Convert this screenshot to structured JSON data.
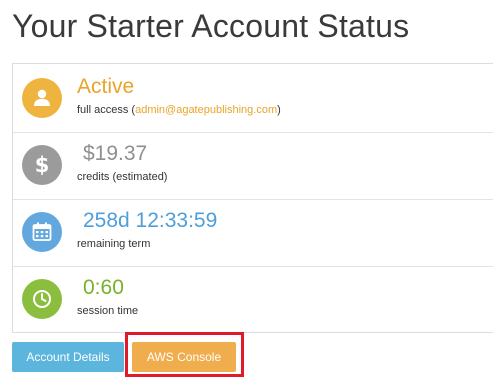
{
  "page": {
    "title": "Your Starter Account Status"
  },
  "status": {
    "account": {
      "value": "Active",
      "label_prefix": "full access (",
      "email": "admin@agatepublishing.com",
      "label_suffix": ")",
      "icon": "user-icon",
      "color": "#efb43f"
    },
    "credits": {
      "value": "$19.37",
      "label": "credits (estimated)",
      "icon": "dollar-icon",
      "color": "#9b9b9b"
    },
    "term": {
      "value": "258d 12:33:59",
      "label": "remaining term",
      "icon": "calendar-icon",
      "color": "#62a8df"
    },
    "session": {
      "value": "0:60",
      "label": "session time",
      "icon": "clock-icon",
      "color": "#8bbe3e"
    }
  },
  "actions": {
    "account_details_label": "Account Details",
    "aws_console_label": "AWS Console",
    "highlight_color": "#e0192b"
  }
}
